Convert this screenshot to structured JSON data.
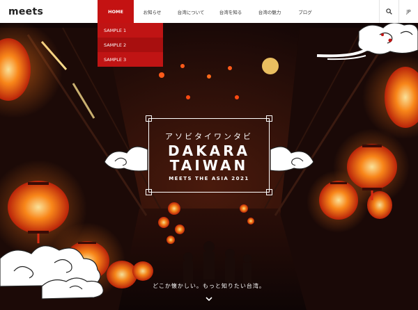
{
  "brand": {
    "logo": "meets"
  },
  "nav": {
    "items": [
      {
        "label": "HOME",
        "active": true
      },
      {
        "label": "お知らせ"
      },
      {
        "label": "台湾について"
      },
      {
        "label": "台湾を知る"
      },
      {
        "label": "台湾の魅力"
      },
      {
        "label": "ブログ"
      }
    ],
    "search_icon": "search-icon",
    "language": "JP"
  },
  "dropdown": {
    "items": [
      {
        "label": "SAMPLE 1"
      },
      {
        "label": "SAMPLE 2"
      },
      {
        "label": "SAMPLE 3"
      }
    ]
  },
  "hero": {
    "kana": "アソビタイワンタビ",
    "title_line1": "DAKARA",
    "title_line2": "TAIWAN",
    "subtitle": "MEETS THE ASIA 2021",
    "tagline": "どこか懐かしい。もっと知りたい台湾。",
    "scroll_icon": "chevron-down-icon"
  },
  "colors": {
    "accent": "#c41212",
    "lantern": "#ff7a12",
    "header_bg": "#ffffff"
  }
}
